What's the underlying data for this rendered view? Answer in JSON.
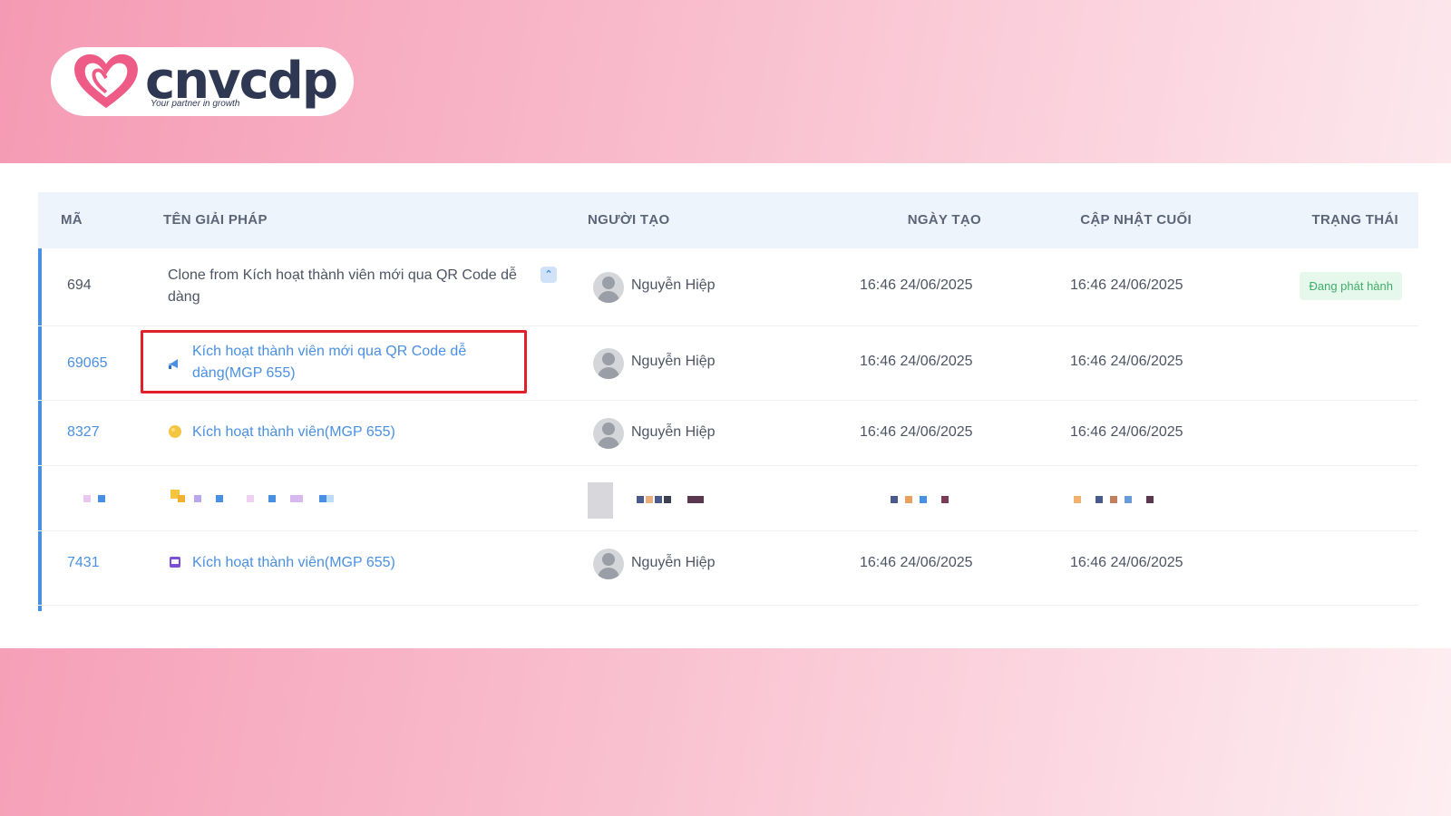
{
  "logo": {
    "brand": "cnvcdp",
    "tagline": "Your partner in growth",
    "colors": {
      "heart": "#ee5b86",
      "text": "#2f3853"
    }
  },
  "table": {
    "headers": {
      "code": "MÃ",
      "name": "TÊN GIẢI PHÁP",
      "creator": "NGƯỜI TẠO",
      "created": "NGÀY TẠO",
      "updated": "CẬP NHẬT CUỐI",
      "status": "TRẠNG THÁI"
    },
    "rows": [
      {
        "code": "694",
        "name": "Clone from Kích hoạt thành viên mới qua QR Code dễ dàng",
        "creator": "Nguyễn Hiệp",
        "created": "16:46 24/06/2025",
        "updated": "16:46 24/06/2025",
        "status": "Đang phát hành",
        "icon": "chevron-up-icon"
      },
      {
        "code": "69065",
        "name": "Kích hoạt thành viên mới qua QR Code dễ dàng(MGP 655)",
        "creator": "Nguyễn Hiệp",
        "created": "16:46 24/06/2025",
        "updated": "16:46 24/06/2025",
        "icon": "megaphone-icon"
      },
      {
        "code": "8327",
        "name": "Kích hoạt thành viên(MGP 655)",
        "creator": "Nguyễn Hiệp",
        "created": "16:46 24/06/2025",
        "updated": "16:46 24/06/2025",
        "icon": "gift-icon"
      },
      {
        "redacted": true
      },
      {
        "code": "7431",
        "name": "Kích hoạt thành viên(MGP 655)",
        "creator": "Nguyễn Hiệp",
        "created": "16:46 24/06/2025",
        "updated": "16:46 24/06/2025",
        "icon": "card-icon"
      }
    ]
  },
  "colors": {
    "link": "#4a90e2",
    "highlight": "#e0202a",
    "status_badge_bg": "#e6f7ec",
    "status_badge_text": "#3fae67",
    "header_bg": "#edf4fb"
  }
}
